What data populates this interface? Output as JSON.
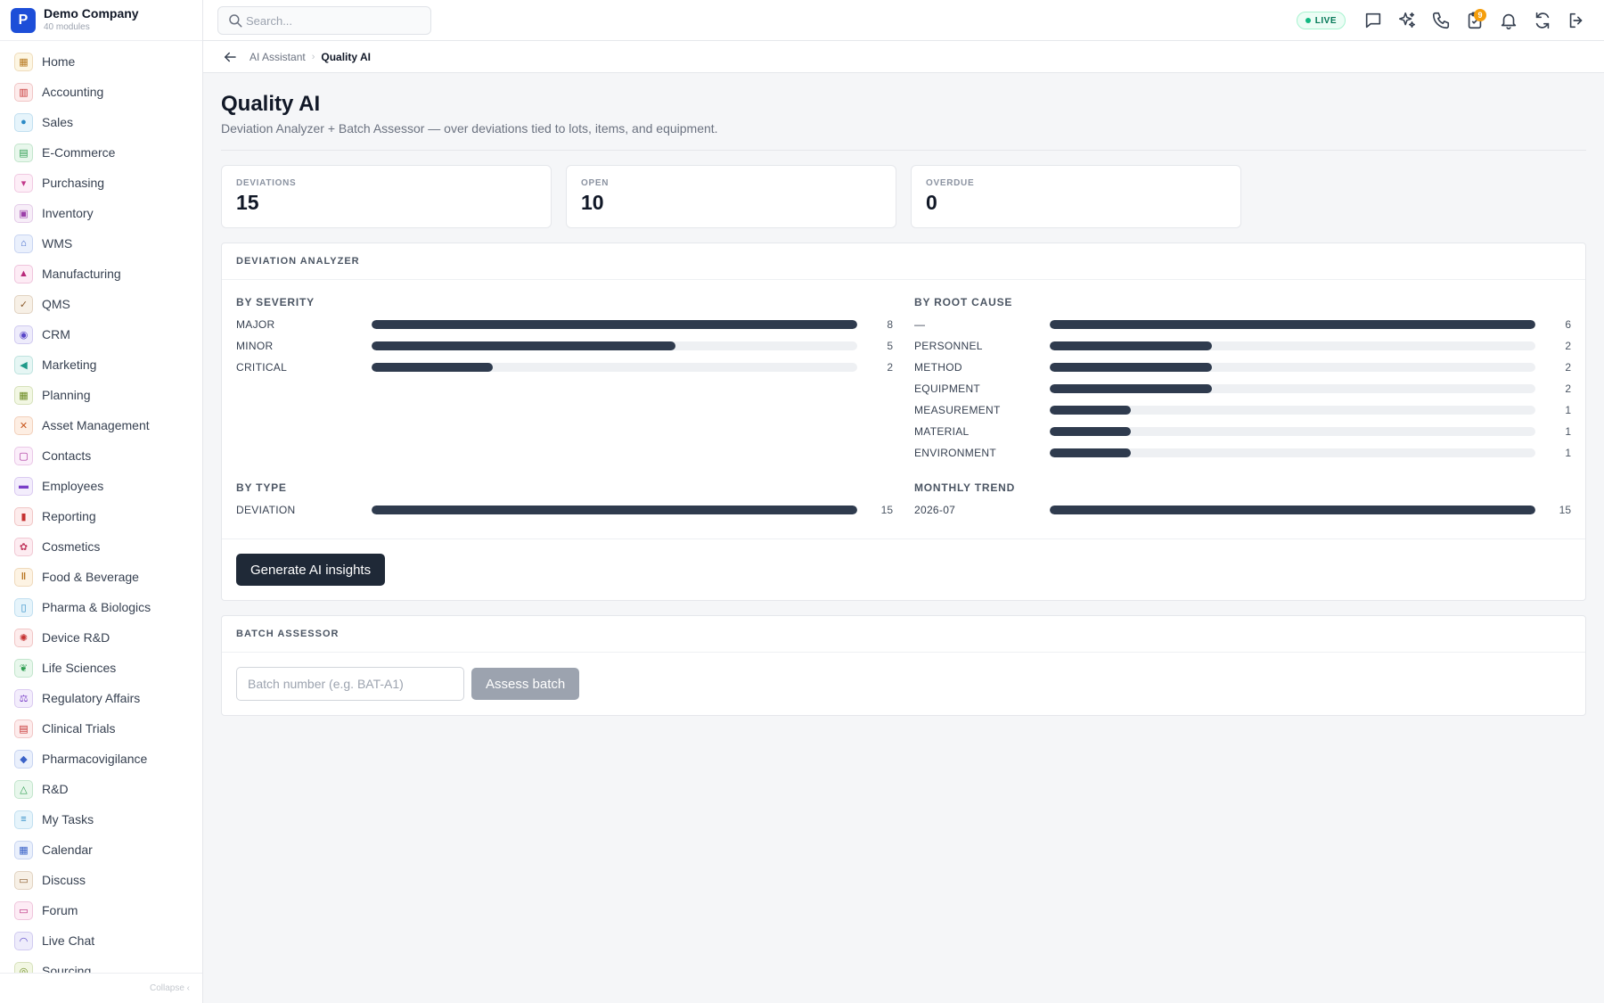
{
  "brand": {
    "logo_letter": "P",
    "name": "Demo Company",
    "subtitle": "40 modules"
  },
  "sidebar": {
    "items": [
      {
        "label": "Home",
        "icon": "grid-icon",
        "bg": "#fdf6e3",
        "fg": "#b7791f"
      },
      {
        "label": "Accounting",
        "icon": "bank-icon",
        "bg": "#fdecec",
        "fg": "#c53030"
      },
      {
        "label": "Sales",
        "icon": "person-icon",
        "bg": "#e6f4fb",
        "fg": "#2b8ac6"
      },
      {
        "label": "E-Commerce",
        "icon": "store-icon",
        "bg": "#e8f7ec",
        "fg": "#2f9e52"
      },
      {
        "label": "Purchasing",
        "icon": "cart-icon",
        "bg": "#fdeef7",
        "fg": "#c2378a"
      },
      {
        "label": "Inventory",
        "icon": "box-icon",
        "bg": "#f7eef8",
        "fg": "#9c3fa8"
      },
      {
        "label": "WMS",
        "icon": "warehouse-icon",
        "bg": "#eaf0fc",
        "fg": "#3b63c8"
      },
      {
        "label": "Manufacturing",
        "icon": "factory-icon",
        "bg": "#fdecf5",
        "fg": "#b8287a"
      },
      {
        "label": "QMS",
        "icon": "check-badge-icon",
        "bg": "#f7f0e6",
        "fg": "#8a5a2b"
      },
      {
        "label": "CRM",
        "icon": "people-icon",
        "bg": "#eeecfb",
        "fg": "#5a48c8"
      },
      {
        "label": "Marketing",
        "icon": "megaphone-icon",
        "bg": "#e6f6f4",
        "fg": "#1f9a8a"
      },
      {
        "label": "Planning",
        "icon": "calendar-grid-icon",
        "bg": "#f2f7e3",
        "fg": "#6a8a1f"
      },
      {
        "label": "Asset Management",
        "icon": "tools-icon",
        "bg": "#fdeee3",
        "fg": "#c8581f"
      },
      {
        "label": "Contacts",
        "icon": "contact-card-icon",
        "bg": "#fbeefa",
        "fg": "#a8309a"
      },
      {
        "label": "Employees",
        "icon": "briefcase-icon",
        "bg": "#f3edfc",
        "fg": "#7a3fc8"
      },
      {
        "label": "Reporting",
        "icon": "bar-chart-icon",
        "bg": "#fdecec",
        "fg": "#c53030"
      },
      {
        "label": "Cosmetics",
        "icon": "flower-icon",
        "bg": "#fdecf1",
        "fg": "#c23a60"
      },
      {
        "label": "Food & Beverage",
        "icon": "utensils-icon",
        "bg": "#fdf3e3",
        "fg": "#b8741f"
      },
      {
        "label": "Pharma & Biologics",
        "icon": "pill-bottle-icon",
        "bg": "#e6f4fb",
        "fg": "#2b8ac6"
      },
      {
        "label": "Device R&D",
        "icon": "gear-icon",
        "bg": "#fdecec",
        "fg": "#c53030"
      },
      {
        "label": "Life Sciences",
        "icon": "leaf-icon",
        "bg": "#e8f7ec",
        "fg": "#2f9e52"
      },
      {
        "label": "Regulatory Affairs",
        "icon": "gavel-icon",
        "bg": "#f3edfc",
        "fg": "#7a3fc8"
      },
      {
        "label": "Clinical Trials",
        "icon": "clipboard-icon",
        "bg": "#fdecec",
        "fg": "#c53030"
      },
      {
        "label": "Pharmacovigilance",
        "icon": "shield-icon",
        "bg": "#eaf0fc",
        "fg": "#3b63c8"
      },
      {
        "label": "R&D",
        "icon": "flask-icon",
        "bg": "#e8f7ec",
        "fg": "#2f9e52"
      },
      {
        "label": "My Tasks",
        "icon": "checklist-icon",
        "bg": "#e6f4fb",
        "fg": "#2b8ac6"
      },
      {
        "label": "Calendar",
        "icon": "calendar-icon",
        "bg": "#eaf0fc",
        "fg": "#3b63c8"
      },
      {
        "label": "Discuss",
        "icon": "chat-bubbles-icon",
        "bg": "#f7f0e6",
        "fg": "#8a5a2b"
      },
      {
        "label": "Forum",
        "icon": "forum-icon",
        "bg": "#fdecf5",
        "fg": "#b8287a"
      },
      {
        "label": "Live Chat",
        "icon": "headset-icon",
        "bg": "#eeecfb",
        "fg": "#5a48c8"
      },
      {
        "label": "Sourcing",
        "icon": "target-icon",
        "bg": "#f2f7e3",
        "fg": "#6a8a1f"
      }
    ],
    "collapse_label": "Collapse ‹"
  },
  "topbar": {
    "search_placeholder": "Search...",
    "live_label": "LIVE",
    "notification_count": "9"
  },
  "breadcrumb": {
    "parent": "AI Assistant",
    "separator": "›",
    "current": "Quality AI"
  },
  "page": {
    "title": "Quality AI",
    "subtitle": "Deviation Analyzer + Batch Assessor — over deviations tied to lots, items, and equipment."
  },
  "kpis": [
    {
      "label": "DEVIATIONS",
      "value": "15"
    },
    {
      "label": "OPEN",
      "value": "10"
    },
    {
      "label": "OVERDUE",
      "value": "0"
    }
  ],
  "analyzer": {
    "title": "DEVIATION ANALYZER",
    "blocks": [
      {
        "title": "BY SEVERITY",
        "max": 8,
        "rows": [
          {
            "label": "MAJOR",
            "value": 8
          },
          {
            "label": "MINOR",
            "value": 5
          },
          {
            "label": "CRITICAL",
            "value": 2
          }
        ]
      },
      {
        "title": "BY ROOT CAUSE",
        "max": 6,
        "rows": [
          {
            "label": "—",
            "value": 6
          },
          {
            "label": "PERSONNEL",
            "value": 2
          },
          {
            "label": "METHOD",
            "value": 2
          },
          {
            "label": "EQUIPMENT",
            "value": 2
          },
          {
            "label": "MEASUREMENT",
            "value": 1
          },
          {
            "label": "MATERIAL",
            "value": 1
          },
          {
            "label": "ENVIRONMENT",
            "value": 1
          }
        ]
      },
      {
        "title": "BY TYPE",
        "max": 15,
        "rows": [
          {
            "label": "DEVIATION",
            "value": 15
          }
        ]
      },
      {
        "title": "MONTHLY TREND",
        "max": 15,
        "rows": [
          {
            "label": "2026-07",
            "value": 15
          }
        ]
      }
    ],
    "button_label": "Generate AI insights"
  },
  "batch": {
    "title": "BATCH ASSESSOR",
    "input_placeholder": "Batch number (e.g. BAT-A1)",
    "button_label": "Assess batch"
  }
}
